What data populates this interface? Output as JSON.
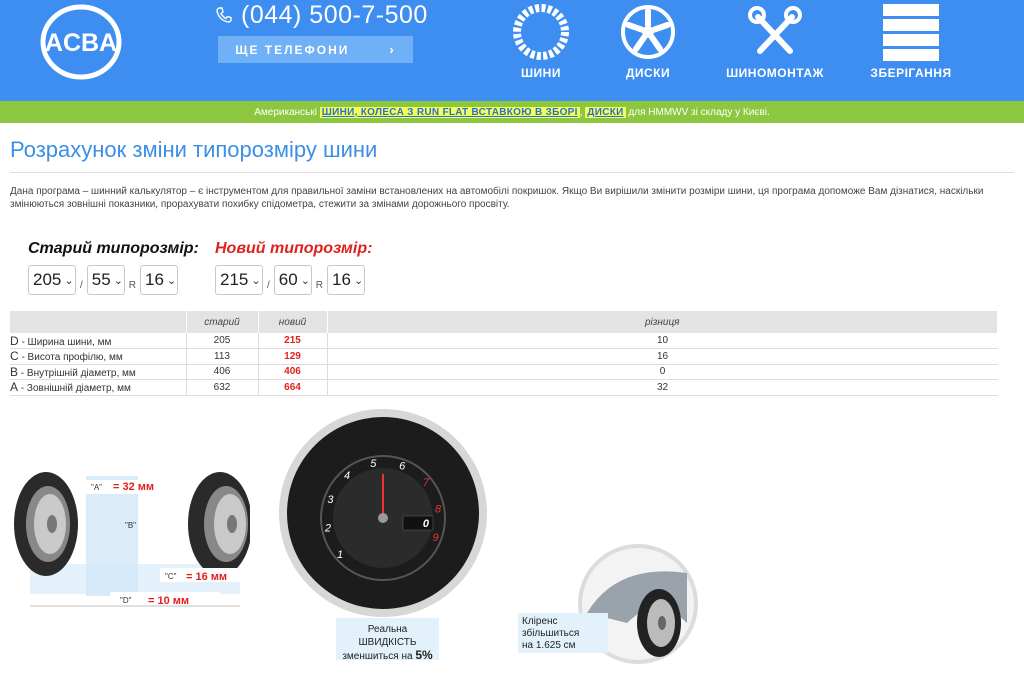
{
  "header": {
    "logo_text": "ACBA",
    "phone": "(044) 500-7-500",
    "phones_button": "ЩЕ ТЕЛЕФОНИ",
    "nav": [
      {
        "label": "ШИНИ",
        "icon": "tire-icon"
      },
      {
        "label": "ДИСКИ",
        "icon": "wheel-rim-icon"
      },
      {
        "label": "ШИНОМОНТАЖ",
        "icon": "tools-icon"
      },
      {
        "label": "ЗБЕРІГАННЯ",
        "icon": "storage-icon"
      }
    ],
    "background_color": "#3d8ef0"
  },
  "promo": {
    "prefix": "Американські",
    "link1": "ШИНИ, КОЛЕСА З RUN FLAT ВСТАВКОЮ В ЗБОРІ",
    "comma": ",",
    "link2": "ДИСКИ",
    "suffix": "для HMMWV зі складу у Києві.",
    "background_color": "#8dc63f"
  },
  "page": {
    "title": "Розрахунок зміни типорозміру шини",
    "description": "Дана програма – шинний калькулятор – є інструментом для правильної заміни встановлених на автомобілі покришок. Якщо Ви вирішили змінити розміри шини, ця програма допоможе Вам дізнатися, наскільки змінюються зовнішні показники, прорахувати похибку спідометра, стежити за змінами дорожнього просвіту."
  },
  "old_size": {
    "label": "Старий типорозмір:",
    "width": "205",
    "sep1": "/",
    "profile": "55",
    "sep2": "R",
    "diameter": "16"
  },
  "new_size": {
    "label": "Новий типорозмір:",
    "width": "215",
    "sep1": "/",
    "profile": "60",
    "sep2": "R",
    "diameter": "16",
    "accent_color": "#e0211d"
  },
  "table": {
    "headers": [
      "",
      "старий",
      "новий",
      "різниця"
    ],
    "rows": [
      {
        "letter": "D",
        "label": " - Ширина шини, мм",
        "old": "205",
        "new": "215",
        "diff": "10"
      },
      {
        "letter": "C",
        "label": " - Висота профілю, мм",
        "old": "113",
        "new": "129",
        "diff": "16"
      },
      {
        "letter": "B",
        "label": " - Внутрішній діаметр, мм",
        "old": "406",
        "new": "406",
        "diff": "0"
      },
      {
        "letter": "A",
        "label": " - Зовнішній діаметр, мм",
        "old": "632",
        "new": "664",
        "diff": "32"
      }
    ]
  },
  "diagram": {
    "a_label": "\"A\"",
    "a_value": "= 32 мм",
    "b_label": "\"B\"",
    "c_label": "\"C\"",
    "c_value": "= 16 мм",
    "d_label": "\"D\"",
    "d_value": "= 10 мм"
  },
  "speed": {
    "line1": "Реальна ШВИДКІСТЬ",
    "line2": "зменшиться на",
    "value": "5%",
    "gauge_digits": [
      "1",
      "2",
      "3",
      "4",
      "5",
      "6",
      "7",
      "8",
      "9"
    ],
    "display_speed": "0"
  },
  "clearance": {
    "line1": "Кліренс",
    "line2": "збільшиться",
    "line3": "на 1.625 см"
  }
}
